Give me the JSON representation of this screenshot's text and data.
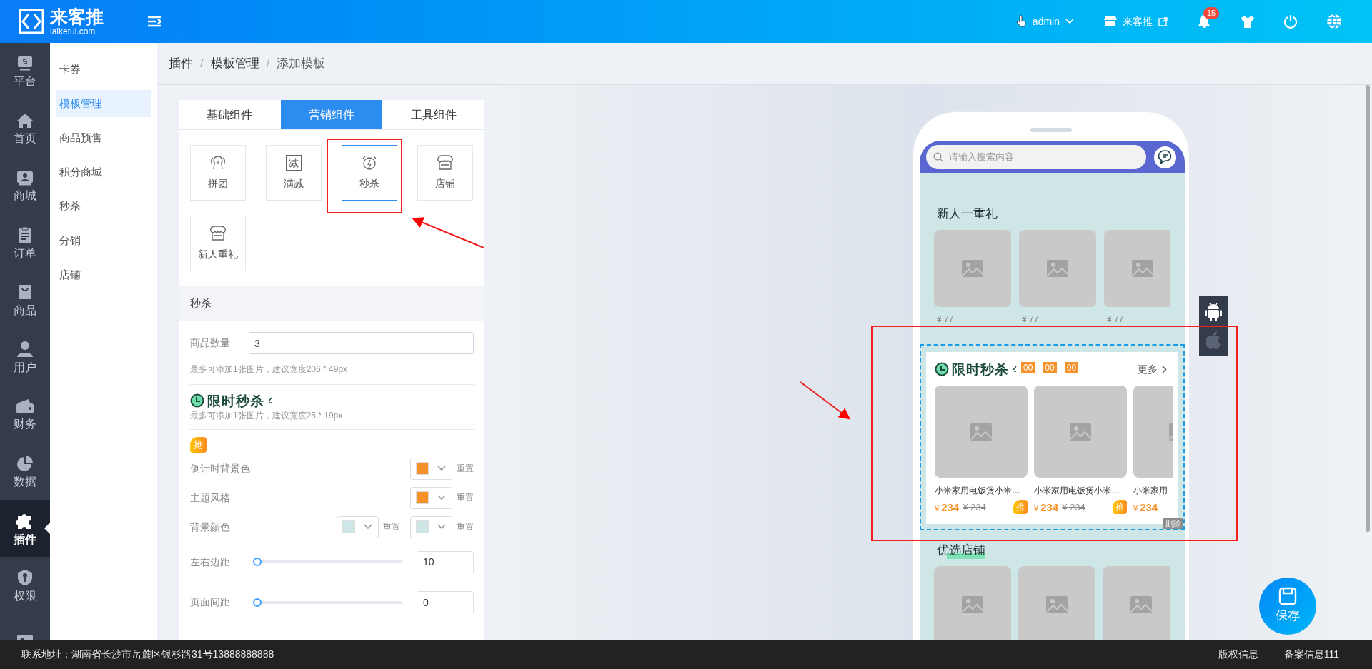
{
  "header": {
    "logo_name": "来客推",
    "logo_domain": "laiketui.com",
    "user": "admin",
    "store": "来客推",
    "notifications": "15"
  },
  "nav": [
    {
      "label": "平台",
      "selected": false
    },
    {
      "label": "首页",
      "selected": false
    },
    {
      "label": "商城",
      "selected": false
    },
    {
      "label": "订单",
      "selected": false
    },
    {
      "label": "商品",
      "selected": false
    },
    {
      "label": "用户",
      "selected": false
    },
    {
      "label": "财务",
      "selected": false
    },
    {
      "label": "数据",
      "selected": false
    },
    {
      "label": "插件",
      "selected": true
    },
    {
      "label": "权限",
      "selected": false
    },
    {
      "selected": false
    }
  ],
  "subnav": [
    {
      "label": "卡券",
      "selected": false
    },
    {
      "label": "模板管理",
      "selected": true
    },
    {
      "label": "商品预售",
      "selected": false
    },
    {
      "label": "积分商城",
      "selected": false
    },
    {
      "label": "秒杀",
      "selected": false
    },
    {
      "label": "分销",
      "selected": false
    },
    {
      "label": "店铺",
      "selected": false
    }
  ],
  "breadcrumb": {
    "items": [
      "插件",
      "模板管理",
      "添加模板"
    ],
    "separators": [
      "/",
      "/"
    ]
  },
  "component_tabs": [
    {
      "label": "基础组件",
      "selected": false
    },
    {
      "label": "营销组件",
      "selected": true
    },
    {
      "label": "工具组件",
      "selected": false
    }
  ],
  "components": [
    {
      "label": "拼团",
      "selected": false
    },
    {
      "label": "满减",
      "glyph": "减",
      "selected": false
    },
    {
      "label": "秒杀",
      "selected": true
    },
    {
      "label": "店铺",
      "selected": false
    },
    {
      "label": "新人重礼",
      "selected": false
    }
  ],
  "settings": {
    "title": "秒杀",
    "rows": [
      {
        "kind": "input",
        "label": "商品数量",
        "value": "3",
        "hint": "最多可添加1张图片，建议宽度206 * 49px"
      },
      {
        "kind": "banner",
        "title": "限时秒杀",
        "hint": "最多可添加1张图片，建议宽度25 * 19px"
      },
      {
        "kind": "badge",
        "text": "抢"
      },
      {
        "kind": "color",
        "label": "倒计时背景色",
        "pickers": [
          {
            "color": "#f7922a",
            "reset": "重置"
          }
        ]
      },
      {
        "kind": "color",
        "label": "主题风格",
        "pickers": [
          {
            "color": "#f7922a",
            "reset": "重置"
          }
        ]
      },
      {
        "kind": "color",
        "label": "背景颜色",
        "pickers": [
          {
            "color": "#cfe6e6",
            "reset": "重置"
          },
          {
            "color": "#cfe6e6",
            "reset": "重置"
          }
        ]
      },
      {
        "kind": "slider",
        "label": "左右边距",
        "level": 0,
        "value": "10"
      },
      {
        "kind": "slider",
        "label": "页面间距",
        "level": 0,
        "value": "0"
      }
    ]
  },
  "preview": {
    "search_placeholder": "请输入搜索内容",
    "gift": {
      "title": "新人一重礼",
      "items": [
        {
          "price": "¥ 77"
        },
        {
          "price": "¥ 77"
        },
        {
          "price": "¥ 77"
        }
      ]
    },
    "flash_sale": {
      "title": "限时秒杀",
      "countdown": [
        "00",
        "00",
        "00"
      ],
      "more": "更多",
      "delete": "删除",
      "products": [
        {
          "name": "小米家用电饭煲小米…",
          "currency": "¥",
          "price": "234",
          "original": "¥ 234",
          "badge": "抢"
        },
        {
          "name": "小米家用电饭煲小米…",
          "currency": "¥",
          "price": "234",
          "original": "¥ 234",
          "badge": "抢"
        },
        {
          "name": "小米家用",
          "currency": "¥",
          "price": "234"
        }
      ]
    },
    "shop": {
      "title": "优选店铺"
    }
  },
  "save": "保存",
  "footer": {
    "address": "联系地址：湖南省长沙市岳麓区银杉路31号13888888888",
    "links": [
      "版权信息",
      "备案信息111"
    ]
  }
}
